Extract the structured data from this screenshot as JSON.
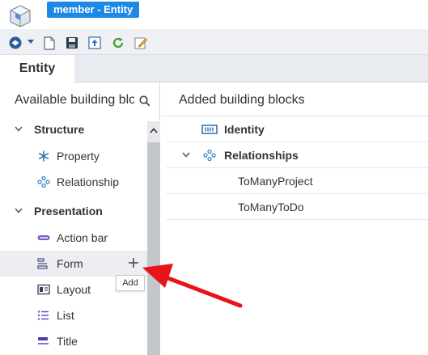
{
  "window": {
    "title": "member - Entity"
  },
  "toolbar": {
    "icons": [
      "app-menu-icon",
      "new-document-icon",
      "save-icon",
      "publish-icon",
      "refresh-icon",
      "edit-icon"
    ]
  },
  "tabs": [
    {
      "label": "Entity",
      "active": true
    }
  ],
  "left_panel": {
    "title": "Available building blocks",
    "sections": [
      {
        "label": "Structure",
        "expanded": true,
        "items": [
          {
            "label": "Property",
            "icon": "asterisk-icon"
          },
          {
            "label": "Relationship",
            "icon": "relationship-icon"
          }
        ]
      },
      {
        "label": "Presentation",
        "expanded": true,
        "items": [
          {
            "label": "Action bar",
            "icon": "action-bar-icon"
          },
          {
            "label": "Form",
            "icon": "form-icon",
            "hovered": true
          },
          {
            "label": "Layout",
            "icon": "layout-icon"
          },
          {
            "label": "List",
            "icon": "list-icon"
          },
          {
            "label": "Title",
            "icon": "title-icon"
          }
        ]
      }
    ],
    "add_tooltip": "Add"
  },
  "right_panel": {
    "title": "Added building blocks",
    "rows": [
      {
        "label": "Identity",
        "icon": "identity-icon",
        "level": 0
      },
      {
        "label": "Relationships",
        "icon": "relationship-icon",
        "level": 0,
        "expanded": true
      },
      {
        "label": "ToManyProject",
        "level": 1
      },
      {
        "label": "ToManyToDo",
        "level": 1
      }
    ]
  },
  "colors": {
    "accent": "#1e88e5",
    "annotation_arrow": "#e8131b"
  }
}
